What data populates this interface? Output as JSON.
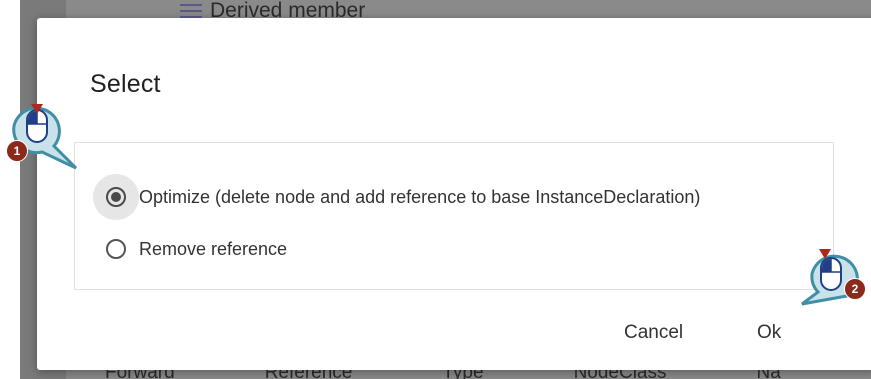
{
  "background": {
    "top_item": "Derived member",
    "bottom_columns": [
      "Forward",
      "Reference",
      "Type",
      "NodeClass",
      "Na"
    ]
  },
  "dialog": {
    "title": "Select",
    "options": [
      {
        "label": "Optimize (delete node and add reference to base InstanceDeclaration)",
        "selected": true
      },
      {
        "label": "Remove reference",
        "selected": false
      }
    ],
    "cancel_label": "Cancel",
    "ok_label": "Ok"
  },
  "callouts": [
    {
      "number": "1",
      "icon": "mouse-left-click-icon"
    },
    {
      "number": "2",
      "icon": "mouse-left-click-icon"
    }
  ],
  "colors": {
    "badge": "#8b2a1a",
    "callout_fill": "#c9e2ea",
    "callout_stroke": "#3f8fa7",
    "mouse_blue": "#1f3f87",
    "click_arrow": "#b0281c"
  }
}
